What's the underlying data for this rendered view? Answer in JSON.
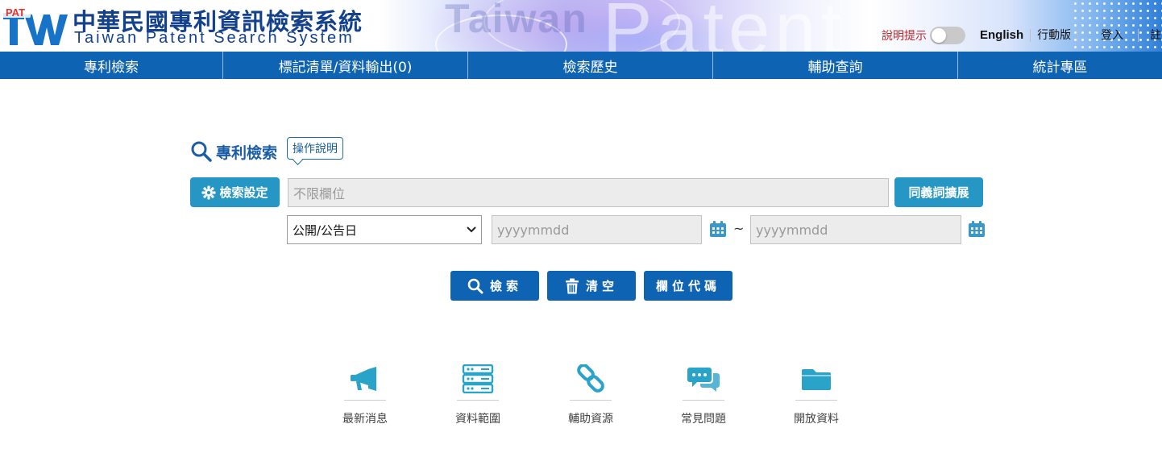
{
  "header": {
    "logo_text": "PAT",
    "title_zh": "中華民國專利資訊檢索系統",
    "title_en": "Taiwan Patent Search System",
    "watermark_1": "Taiwan",
    "watermark_2": "Patent",
    "help_toggle_label": "說明提示",
    "help_toggle_on": false,
    "links": [
      "English",
      "行動版",
      "登入",
      "註"
    ]
  },
  "nav": {
    "items": [
      "專利檢索",
      "標記清單/資料輸出(0)",
      "檢索歷史",
      "輔助查詢",
      "統計專區"
    ]
  },
  "search": {
    "section_title": "專利檢索",
    "guide_label": "操作說明",
    "settings_label": "檢索設定",
    "query_placeholder": "不限欄位",
    "synonym_label": "同義詞擴展",
    "date_field_selected": "公開/公告日",
    "date_from_placeholder": "yyyymmdd",
    "date_to_placeholder": "yyyymmdd",
    "range_separator": "~",
    "search_label": "檢索",
    "clear_label": "清空",
    "field_code_label": "欄位代碼"
  },
  "quick_links": [
    {
      "label": "最新消息",
      "icon": "megaphone-icon"
    },
    {
      "label": "資料範圍",
      "icon": "server-icon"
    },
    {
      "label": "輔助資源",
      "icon": "link-icon"
    },
    {
      "label": "常見問題",
      "icon": "chat-bubbles-icon"
    },
    {
      "label": "開放資料",
      "icon": "folder-icon"
    }
  ],
  "colors": {
    "nav_bg": "#0e63b2",
    "teal_button": "#2697c4",
    "title_blue": "#14418c",
    "help_red": "#c7252b",
    "icon_teal": "#2aa3c9"
  }
}
